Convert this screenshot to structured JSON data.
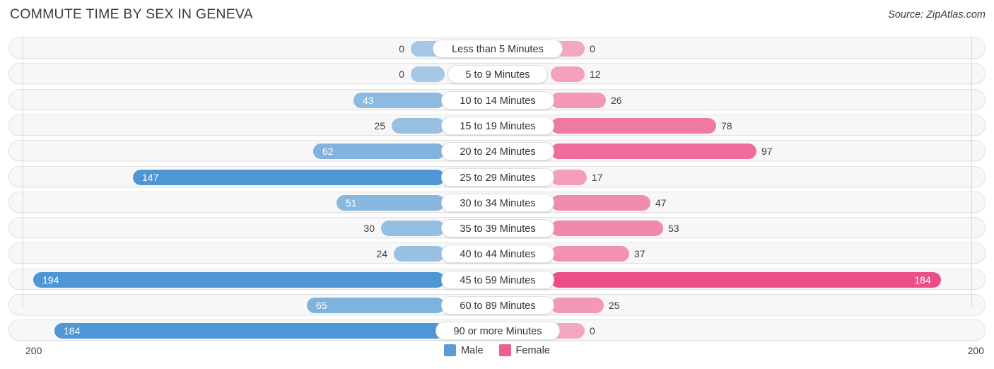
{
  "header": {
    "title": "COMMUTE TIME BY SEX IN GENEVA",
    "source": "Source: ZipAtlas.com"
  },
  "axis": {
    "left_label": "200",
    "right_label": "200",
    "max": 200
  },
  "legend": {
    "items": [
      {
        "label": "Male",
        "color": "#5b9bd5",
        "icon": "male-swatch"
      },
      {
        "label": "Female",
        "color": "#ec5f8f",
        "icon": "female-swatch"
      }
    ]
  },
  "chart_data": {
    "type": "bar",
    "title": "COMMUTE TIME BY SEX IN GENEVA",
    "subtitle": "",
    "orientation": "horizontal-diverging",
    "xlabel": "",
    "ylabel": "",
    "xlim": [
      200,
      200
    ],
    "grid": true,
    "legend_position": "bottom-center",
    "categories": [
      "Less than 5 Minutes",
      "5 to 9 Minutes",
      "10 to 14 Minutes",
      "15 to 19 Minutes",
      "20 to 24 Minutes",
      "25 to 29 Minutes",
      "30 to 34 Minutes",
      "35 to 39 Minutes",
      "40 to 44 Minutes",
      "45 to 59 Minutes",
      "60 to 89 Minutes",
      "90 or more Minutes"
    ],
    "series": [
      {
        "name": "Male",
        "color": "#5b9bd5",
        "values": [
          0,
          0,
          43,
          25,
          62,
          147,
          51,
          30,
          24,
          194,
          65,
          184
        ]
      },
      {
        "name": "Female",
        "color": "#ec5f8f",
        "values": [
          0,
          12,
          26,
          78,
          97,
          17,
          47,
          53,
          37,
          184,
          25,
          0
        ]
      }
    ]
  },
  "rows": [
    {
      "label": "Less than 5 Minutes",
      "male": "0",
      "female": "0"
    },
    {
      "label": "5 to 9 Minutes",
      "male": "0",
      "female": "12"
    },
    {
      "label": "10 to 14 Minutes",
      "male": "43",
      "female": "26"
    },
    {
      "label": "15 to 19 Minutes",
      "male": "25",
      "female": "78"
    },
    {
      "label": "20 to 24 Minutes",
      "male": "62",
      "female": "97"
    },
    {
      "label": "25 to 29 Minutes",
      "male": "147",
      "female": "17"
    },
    {
      "label": "30 to 34 Minutes",
      "male": "51",
      "female": "47"
    },
    {
      "label": "35 to 39 Minutes",
      "male": "30",
      "female": "53"
    },
    {
      "label": "40 to 44 Minutes",
      "male": "24",
      "female": "37"
    },
    {
      "label": "45 to 59 Minutes",
      "male": "194",
      "female": "184"
    },
    {
      "label": "60 to 89 Minutes",
      "male": "65",
      "female": "25"
    },
    {
      "label": "90 or more Minutes",
      "male": "184",
      "female": "0"
    }
  ]
}
